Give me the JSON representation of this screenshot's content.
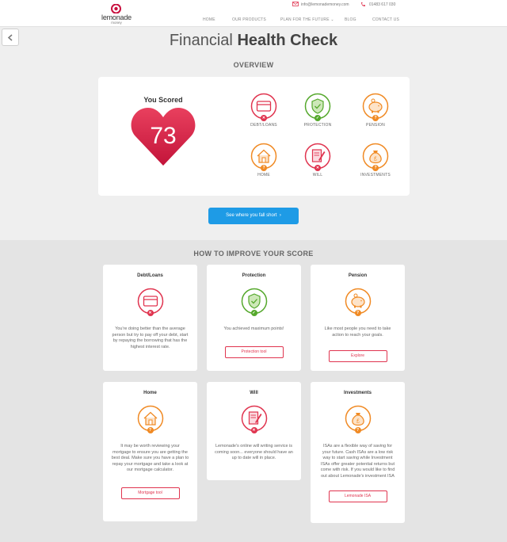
{
  "header": {
    "brand": "lemonade",
    "brand_sub": "money",
    "email": "info@lemonademoney.com",
    "phone": "01483 617 030",
    "nav": [
      "HOME",
      "OUR PRODUCTS",
      "PLAN FOR THE FUTURE",
      "BLOG",
      "CONTACT US"
    ]
  },
  "page": {
    "title_light": "Financial",
    "title_bold": "Health Check",
    "overview_heading": "OVERVIEW",
    "improve_heading": "HOW TO IMPROVE YOUR SCORE"
  },
  "score": {
    "label": "You Scored",
    "value": "73"
  },
  "overview": {
    "items": [
      {
        "label": "DEBT/LOANS",
        "icon": "credit-card-icon",
        "status": "fail"
      },
      {
        "label": "PROTECTION",
        "icon": "shield-icon",
        "status": "pass"
      },
      {
        "label": "PENSION",
        "icon": "piggy-bank-icon",
        "status": "unknown"
      },
      {
        "label": "HOME",
        "icon": "house-icon",
        "status": "unknown"
      },
      {
        "label": "WILL",
        "icon": "will-document-icon",
        "status": "fail"
      },
      {
        "label": "INVESTMENTS",
        "icon": "money-bag-icon",
        "status": "unknown"
      }
    ]
  },
  "cta": {
    "label": "See where you fall short"
  },
  "cards": [
    {
      "title": "Debt/Loans",
      "text": "You're doing better than the average person but try to pay off your debt, start by repaying the borrowing that has the highest interest rate.",
      "button": ""
    },
    {
      "title": "Protection",
      "text": "You achieved maximum points!",
      "button": "Protection tool"
    },
    {
      "title": "Pension",
      "text": "Like most people you need to take action to reach your goals.",
      "button": "Explore"
    },
    {
      "title": "Home",
      "text": "It may be worth reviewing your mortgage to ensure you are getting the best deal. Make sure you have a plan to repay your mortgage and take a look at our mortgage calculator.",
      "button": "Mortgage tool"
    },
    {
      "title": "Will",
      "text": "Lemonade's online will writing service is coming soon... everyone should have an up to date will in place.",
      "button": ""
    },
    {
      "title": "Investments",
      "text": "ISAs are a flexible way of saving for your future. Cash ISAs are a low risk way to start saving while Investment ISAs offer greater potential returns but come with risk. If you would like to find out about Lemonade's investment ISA",
      "button": "Lemonade ISA"
    }
  ],
  "colors": {
    "red": "#e0344f",
    "green": "#55a82c",
    "orange": "#f08a24",
    "blue": "#1e9be6"
  }
}
